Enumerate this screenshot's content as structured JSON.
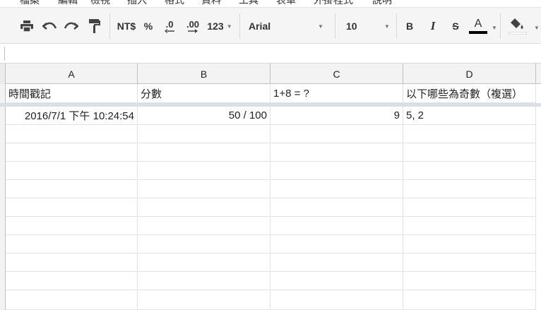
{
  "menu": {
    "items": [
      "檔案",
      "編輯",
      "檢視",
      "插入",
      "格式",
      "資料",
      "工具",
      "表單",
      "外掛程式",
      "說明"
    ]
  },
  "toolbar": {
    "print_icon": "print-icon",
    "undo_icon": "undo-icon",
    "redo_icon": "redo-icon",
    "paint_format_icon": "paint-format-icon",
    "currency_label": "NT$",
    "percent_label": "%",
    "decrease_decimal_label": ".0",
    "increase_decimal_label": ".00",
    "more_formats_label": "123",
    "font_name": "Arial",
    "font_size": "10",
    "bold_label": "B",
    "italic_label": "I",
    "strikethrough_label": "S",
    "text_color_label": "A",
    "text_color": "#000000",
    "fill_color_icon": "fill-color-icon",
    "fill_color": "#ffffff"
  },
  "formula_bar": {
    "value": ""
  },
  "columns": [
    "A",
    "B",
    "C",
    "D"
  ],
  "header_row": [
    "時間戳記",
    "分數",
    "1+8 = ?",
    "以下哪些為奇數（複選）"
  ],
  "data_rows": [
    [
      "2016/7/1 下午 10:24:54",
      "50 / 100",
      "9",
      "5, 2"
    ]
  ],
  "colors": {
    "toolbar_bg": "#f5f5f5",
    "header_bg": "#f3f3f3",
    "freeze_bar": "#dadfe6",
    "gridline": "#e2e2e2"
  }
}
